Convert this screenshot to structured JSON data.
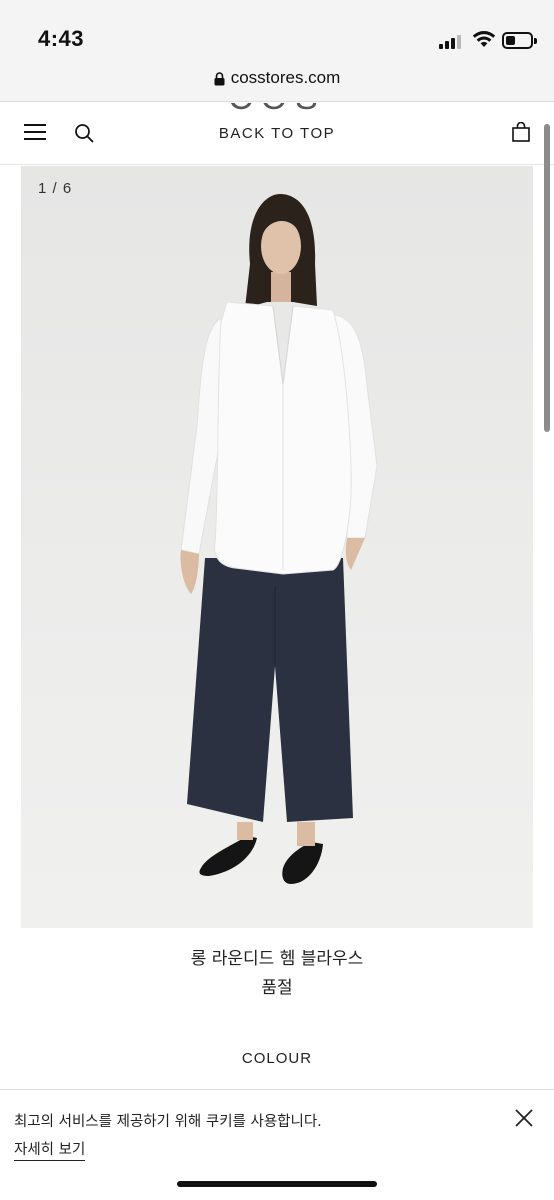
{
  "status_bar": {
    "time": "4:43"
  },
  "browser": {
    "url": "cosstores.com",
    "lock_icon": "lock-icon"
  },
  "header": {
    "menu_icon": "hamburger-icon",
    "search_icon": "search-icon",
    "logo": "COS",
    "back_to_top": "BACK TO TOP",
    "bag_icon": "bag-icon"
  },
  "gallery": {
    "counter": "1 / 6"
  },
  "product": {
    "name": "롱 라운디드 헴 블라우스",
    "status": "품절",
    "colour_label": "COLOUR"
  },
  "cookie": {
    "message": "최고의 서비스를 제공하기 위해 쿠키를 사용합니다.",
    "details_link": "자세히 보기",
    "close_icon": "close-icon"
  }
}
